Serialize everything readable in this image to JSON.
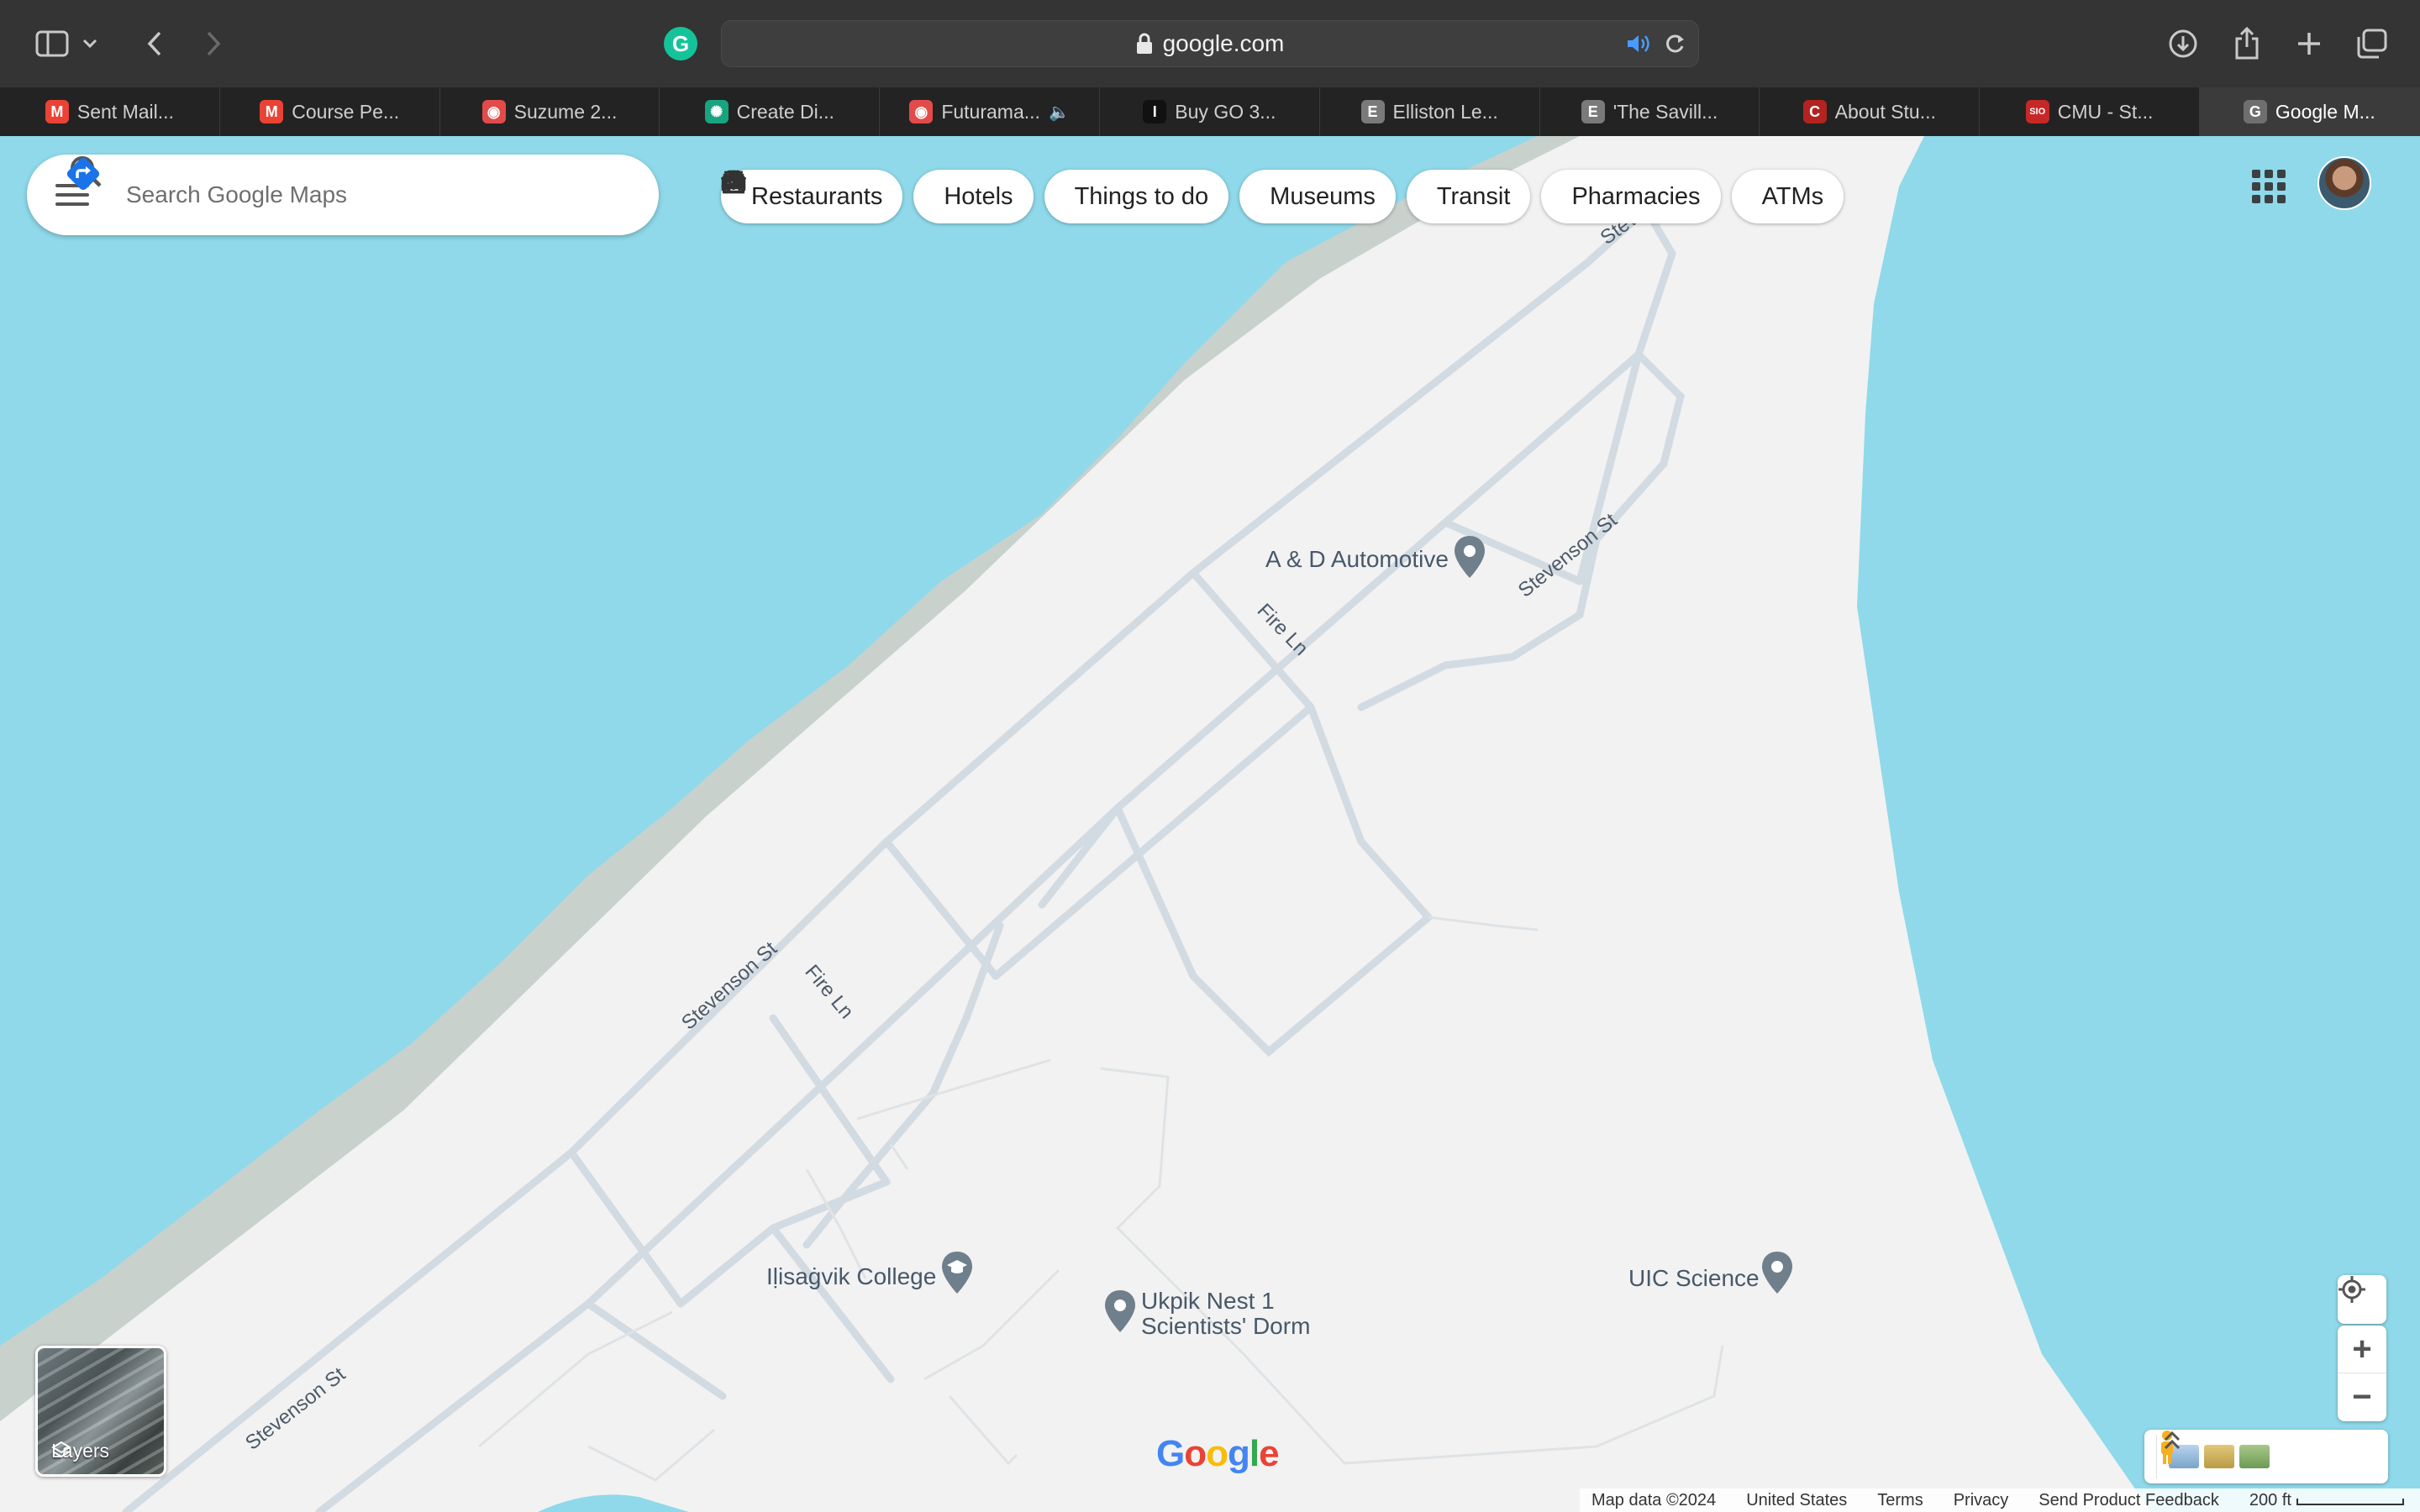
{
  "browser": {
    "url": "google.com",
    "tabs": [
      {
        "label": "Sent Mail...",
        "icon": "gmail-icon",
        "color": "#ea4335",
        "glyph": "M"
      },
      {
        "label": "Course Pe...",
        "icon": "gmail-icon",
        "color": "#ea4335",
        "glyph": "M"
      },
      {
        "label": "Suzume 2...",
        "icon": "red-circle-icon",
        "color": "#e34b4b",
        "glyph": "◉"
      },
      {
        "label": "Create Di...",
        "icon": "openai-icon",
        "color": "#19a37f",
        "glyph": "✺"
      },
      {
        "label": "Futurama...",
        "icon": "red-circle-icon",
        "color": "#e34b4b",
        "glyph": "◉",
        "audio": true
      },
      {
        "label": "Buy GO 3...",
        "icon": "i-square-icon",
        "color": "#111111",
        "glyph": "I"
      },
      {
        "label": "Elliston Le...",
        "icon": "letter-e-icon",
        "color": "#7a7a7a",
        "glyph": "E"
      },
      {
        "label": "'The Savill...",
        "icon": "letter-e-icon",
        "color": "#7a7a7a",
        "glyph": "E"
      },
      {
        "label": "About Stu...",
        "icon": "letter-c-icon",
        "color": "#b3231f",
        "glyph": "C"
      },
      {
        "label": "CMU - St...",
        "icon": "sio-icon",
        "color": "#c62828",
        "glyph": "SIO"
      },
      {
        "label": "Google M...",
        "icon": "letter-g-icon",
        "color": "#6f6f6f",
        "glyph": "G",
        "active": true
      }
    ]
  },
  "search": {
    "placeholder": "Search Google Maps"
  },
  "chips": [
    {
      "label": "Restaurants",
      "icon": "fork-knife-icon"
    },
    {
      "label": "Hotels",
      "icon": "bed-icon"
    },
    {
      "label": "Things to do",
      "icon": "camera-icon"
    },
    {
      "label": "Museums",
      "icon": "museum-icon"
    },
    {
      "label": "Transit",
      "icon": "train-icon"
    },
    {
      "label": "Pharmacies",
      "icon": "pharmacy-icon"
    },
    {
      "label": "ATMs",
      "icon": "atm-icon"
    }
  ],
  "places": {
    "automotive": "A & D Automotive",
    "college": "Iḷisaġvik College",
    "dorm_line1": "Ukpik Nest 1",
    "dorm_line2": "Scientists' Dorm",
    "science": "UIC Science"
  },
  "roads": {
    "stevenson_1": "Stevenson St",
    "stevenson_2": "Stevenson St",
    "stevenson_3": "Stevenson St",
    "stevenson_top": "Steve",
    "fire_1": "Fire Ln",
    "fire_2": "Fire Ln"
  },
  "map": {
    "layers_label": "Layers",
    "logo_text": "Google",
    "water_color": "#8fd9ea",
    "land_color": "#f2f2f2",
    "road_color": "#d6dde3"
  },
  "footer": {
    "map_data": "Map data ©2024",
    "country": "United States",
    "terms": "Terms",
    "privacy": "Privacy",
    "feedback": "Send Product Feedback",
    "scale": "200 ft"
  }
}
